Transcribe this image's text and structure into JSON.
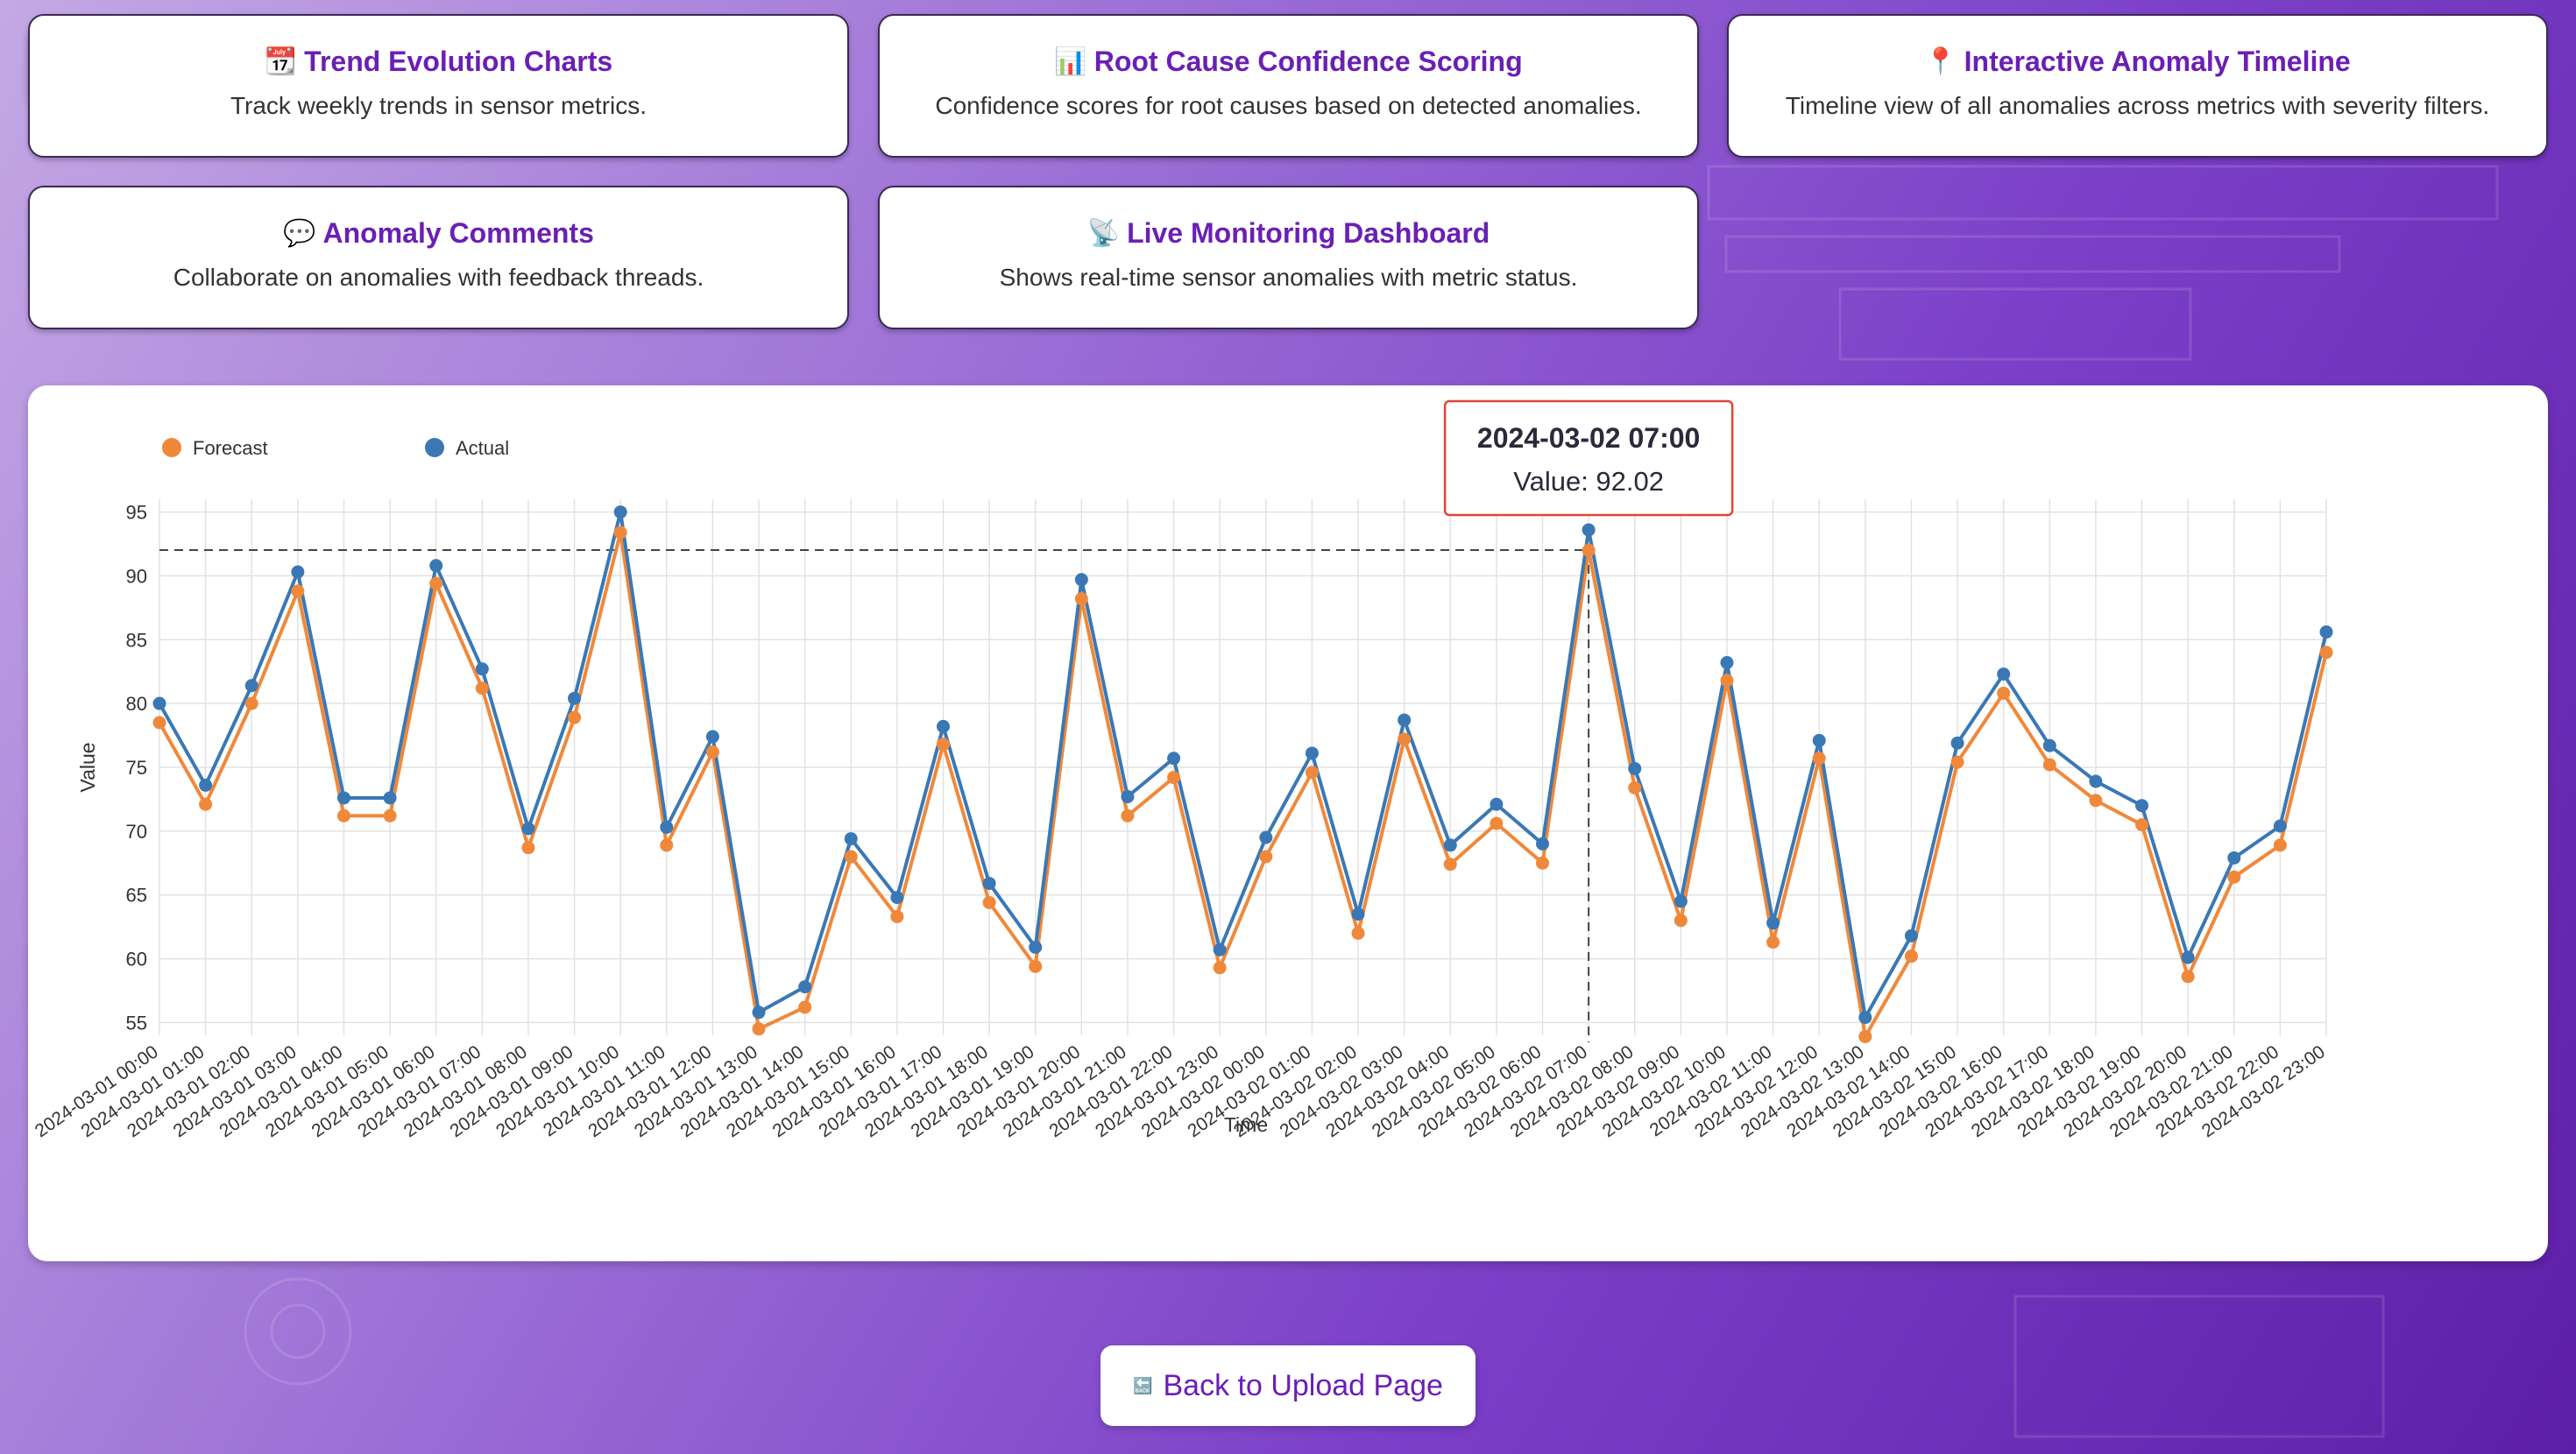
{
  "cards": [
    {
      "icon": "📆",
      "icon_name": "calendar-icon",
      "title": "Trend Evolution Charts",
      "desc": "Track weekly trends in sensor metrics."
    },
    {
      "icon": "📊",
      "icon_name": "bar-chart-icon",
      "title": "Root Cause Confidence Scoring",
      "desc": "Confidence scores for root causes based on detected anomalies."
    },
    {
      "icon": "📍",
      "icon_name": "pin-icon",
      "title": "Interactive Anomaly Timeline",
      "desc": "Timeline view of all anomalies across metrics with severity filters."
    },
    {
      "icon": "💬",
      "icon_name": "speech-bubble-icon",
      "title": "Anomaly Comments",
      "desc": "Collaborate on anomalies with feedback threads."
    },
    {
      "icon": "📡",
      "icon_name": "satellite-dish-icon",
      "title": "Live Monitoring Dashboard",
      "desc": "Shows real-time sensor anomalies with metric status."
    }
  ],
  "back_button": {
    "icon": "🔙",
    "icon_name": "back-icon",
    "label": "Back to Upload Page"
  },
  "colors": {
    "accent": "#6a1fb5",
    "forecast": "#f0883a",
    "actual": "#3a78b5",
    "tooltip_border": "#e0443a"
  },
  "chart_data": {
    "type": "line",
    "xlabel": "Time",
    "ylabel": "Value",
    "ylim": [
      54,
      96
    ],
    "yticks": [
      55,
      60,
      65,
      70,
      75,
      80,
      85,
      90,
      95
    ],
    "grid": true,
    "legend_placement": "top-left",
    "x": [
      "2024-03-01 00:00",
      "2024-03-01 01:00",
      "2024-03-01 02:00",
      "2024-03-01 03:00",
      "2024-03-01 04:00",
      "2024-03-01 05:00",
      "2024-03-01 06:00",
      "2024-03-01 07:00",
      "2024-03-01 08:00",
      "2024-03-01 09:00",
      "2024-03-01 10:00",
      "2024-03-01 11:00",
      "2024-03-01 12:00",
      "2024-03-01 13:00",
      "2024-03-01 14:00",
      "2024-03-01 15:00",
      "2024-03-01 16:00",
      "2024-03-01 17:00",
      "2024-03-01 18:00",
      "2024-03-01 19:00",
      "2024-03-01 20:00",
      "2024-03-01 21:00",
      "2024-03-01 22:00",
      "2024-03-01 23:00",
      "2024-03-02 00:00",
      "2024-03-02 01:00",
      "2024-03-02 02:00",
      "2024-03-02 03:00",
      "2024-03-02 04:00",
      "2024-03-02 05:00",
      "2024-03-02 06:00",
      "2024-03-02 07:00",
      "2024-03-02 08:00",
      "2024-03-02 09:00",
      "2024-03-02 10:00",
      "2024-03-02 11:00",
      "2024-03-02 12:00",
      "2024-03-02 13:00",
      "2024-03-02 14:00",
      "2024-03-02 15:00",
      "2024-03-02 16:00",
      "2024-03-02 17:00",
      "2024-03-02 18:00",
      "2024-03-02 19:00",
      "2024-03-02 20:00",
      "2024-03-02 21:00",
      "2024-03-02 22:00",
      "2024-03-02 23:00"
    ],
    "series": [
      {
        "name": "Forecast",
        "values": [
          78.5,
          72.1,
          80.0,
          88.8,
          71.2,
          71.2,
          89.4,
          81.2,
          68.7,
          78.9,
          93.4,
          68.9,
          76.2,
          54.5,
          56.2,
          68.0,
          63.3,
          76.8,
          64.4,
          59.4,
          88.2,
          71.2,
          74.2,
          59.3,
          68.0,
          74.6,
          62.0,
          77.2,
          67.4,
          70.6,
          67.5,
          92.0,
          73.4,
          63.0,
          81.8,
          61.3,
          75.7,
          53.9,
          60.2,
          75.4,
          80.8,
          75.2,
          72.4,
          70.5,
          58.6,
          66.4,
          68.9,
          84.0
        ]
      },
      {
        "name": "Actual",
        "values": [
          80.0,
          73.6,
          81.4,
          90.3,
          72.6,
          72.6,
          90.8,
          82.7,
          70.2,
          80.4,
          95.0,
          70.3,
          77.4,
          55.8,
          57.8,
          69.4,
          64.8,
          78.2,
          65.9,
          60.9,
          89.7,
          72.7,
          75.7,
          60.7,
          69.5,
          76.1,
          63.5,
          78.7,
          68.9,
          72.1,
          69.0,
          93.6,
          74.9,
          64.5,
          83.2,
          62.8,
          77.1,
          55.4,
          61.8,
          76.9,
          82.3,
          76.7,
          73.9,
          72.0,
          60.1,
          67.9,
          70.4,
          85.6
        ]
      }
    ],
    "tooltip": {
      "time": "2024-03-02 07:00",
      "value_text": "Value: 92.02",
      "index": 31,
      "value": 92.02
    }
  }
}
